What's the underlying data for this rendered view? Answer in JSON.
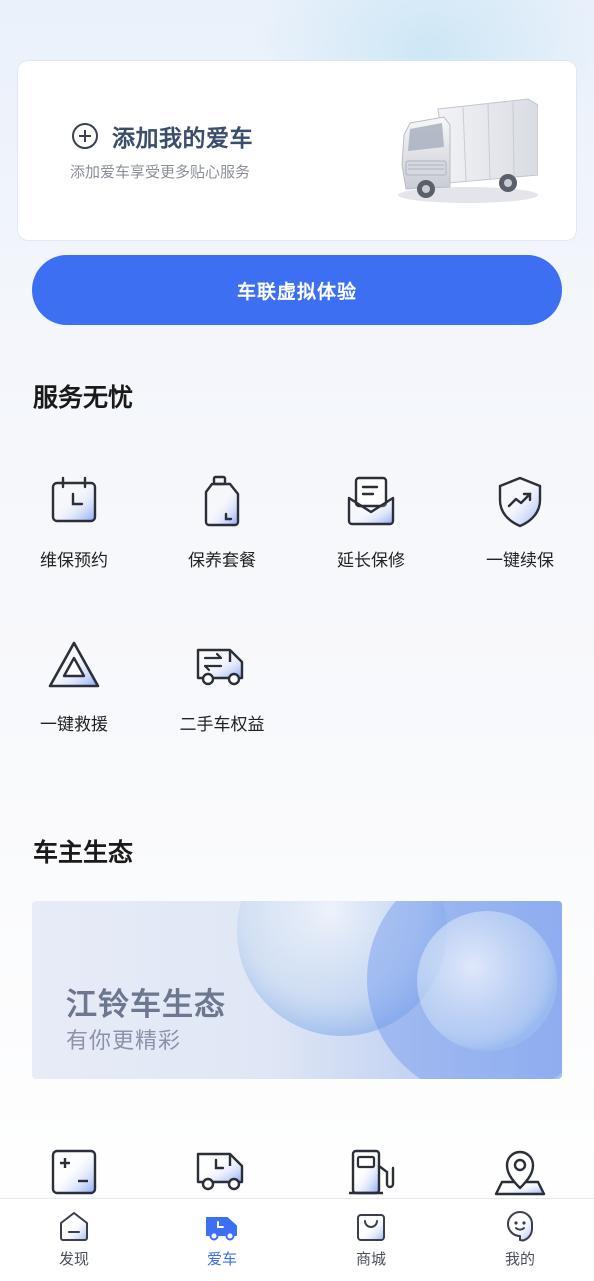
{
  "add_car_card": {
    "title": "添加我的爱车",
    "subtitle": "添加爱车享受更多贴心服务",
    "icon": "plus-circle-icon"
  },
  "experience_button": {
    "label": "车联虚拟体验"
  },
  "services": {
    "title": "服务无忧",
    "items": [
      {
        "label": "维保预约",
        "icon": "calendar-icon"
      },
      {
        "label": "保养套餐",
        "icon": "oil-bottle-icon"
      },
      {
        "label": "延长保修",
        "icon": "envelope-doc-icon"
      },
      {
        "label": "一键续保",
        "icon": "shield-chart-icon"
      },
      {
        "label": "一键救援",
        "icon": "warning-triangle-icon"
      },
      {
        "label": "二手车权益",
        "icon": "truck-transfer-icon"
      }
    ]
  },
  "ecosystem": {
    "title": "车主生态",
    "banner_title": "江铃车生态",
    "banner_subtitle": "有你更精彩",
    "icons": [
      "plus-minus-icon",
      "truck-clock-icon",
      "fuel-pump-icon",
      "map-pin-icon"
    ]
  },
  "tabbar": {
    "items": [
      {
        "label": "发现",
        "icon": "home-icon",
        "active": false
      },
      {
        "label": "爱车",
        "icon": "truck-icon",
        "active": true
      },
      {
        "label": "商城",
        "icon": "shopping-bag-icon",
        "active": false
      },
      {
        "label": "我的",
        "icon": "profile-icon",
        "active": false
      }
    ]
  },
  "colors": {
    "accent": "#3d6ff2",
    "text": "#1a1a1a",
    "muted": "#8a8f99"
  }
}
